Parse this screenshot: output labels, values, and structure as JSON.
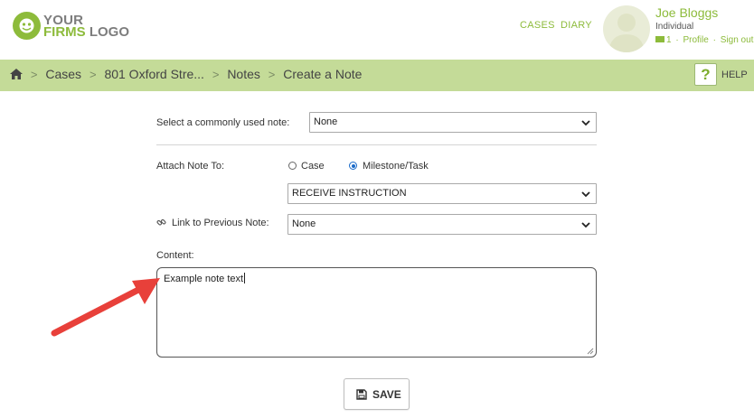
{
  "header": {
    "logo": {
      "line1": "YOUR",
      "line2a": "FIRMS",
      "line2b": "LOGO"
    },
    "nav": {
      "cases": "CASES",
      "diary": "DIARY"
    },
    "user": {
      "name": "Joe Bloggs",
      "role": "Individual",
      "message_count": "1",
      "separator": "·",
      "profile": "Profile",
      "signout": "Sign out"
    }
  },
  "breadcrumb": {
    "items": [
      "Cases",
      "801 Oxford Stre...",
      "Notes",
      "Create a Note"
    ],
    "separator": ">"
  },
  "help": {
    "icon": "?",
    "label": "HELP"
  },
  "form": {
    "common_note": {
      "label": "Select a commonly used note:",
      "value": "None"
    },
    "attach": {
      "label": "Attach Note To:",
      "option_case": "Case",
      "option_milestone": "Milestone/Task",
      "selected": "Milestone/Task",
      "milestone_value": "RECEIVE INSTRUCTION"
    },
    "link_previous": {
      "label": "Link to Previous Note:",
      "value": "None"
    },
    "content": {
      "label": "Content:",
      "value": "Example note text"
    },
    "save_label": "SAVE"
  },
  "colors": {
    "brand_green": "#8dbb3b",
    "breadcrumb_bar": "#c4db98",
    "annotation_arrow": "#e8403a",
    "radio_selected": "#1a6ac9"
  }
}
